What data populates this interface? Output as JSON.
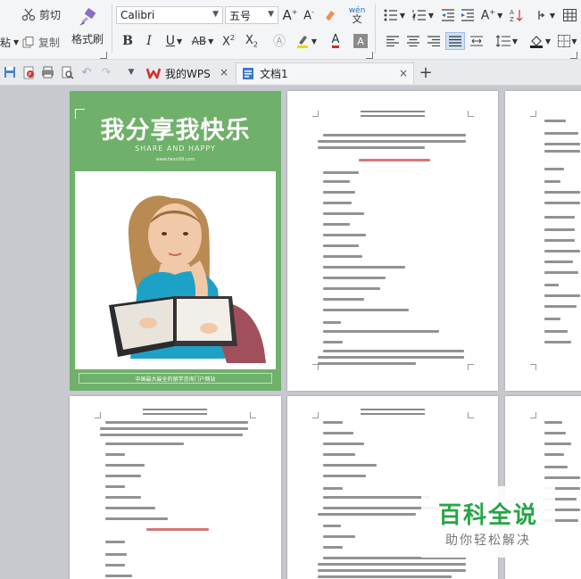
{
  "ribbon": {
    "clipboard": {
      "paste_label": "粘",
      "cut_label": "剪切",
      "copy_label": "复制",
      "format_painter_label": "格式刷"
    },
    "font": {
      "family": "Calibri",
      "size": "五号"
    }
  },
  "tabbar": {
    "tabs": [
      {
        "label": "我的WPS",
        "close": "×"
      },
      {
        "label": "文档1",
        "close": "×"
      }
    ],
    "new_tab": "+"
  },
  "cover": {
    "title": "我分享我快乐",
    "subtitle": "SHARE AND HAPPY",
    "website": "www.fwsir99.com",
    "footer": "中国最大最全的留学咨询门户网站"
  },
  "watermark": {
    "title": "百科全说",
    "subtitle": "助你轻松解决"
  },
  "colors": {
    "cover_green": "#6fb06a",
    "watermark_green": "#27a547",
    "wps_red": "#d0312d",
    "active_tab": "#f5f6f8"
  }
}
